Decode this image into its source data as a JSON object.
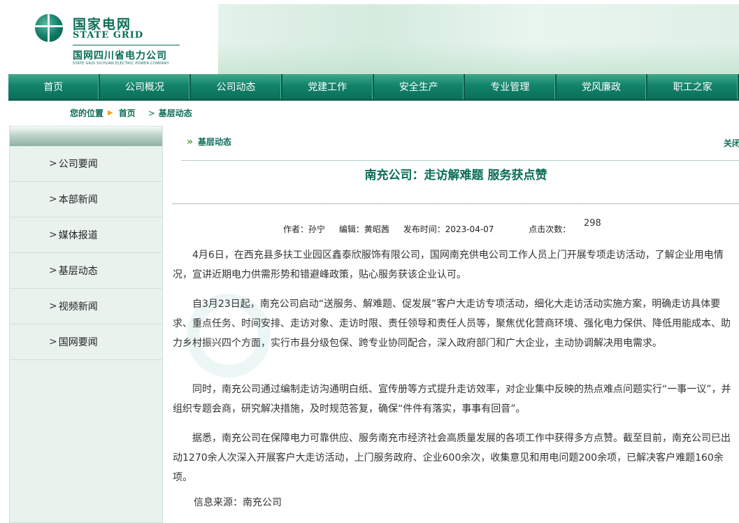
{
  "header": {
    "logo_cn": "国家电网",
    "logo_en": "STATE GRID",
    "company": "国网四川省电力公司",
    "company_en": "STATE GRID SICHUAN ELECTRIC POWER COMPANY"
  },
  "nav": [
    "首页",
    "公司概况",
    "公司动态",
    "党建工作",
    "安全生产",
    "专业管理",
    "党风廉政",
    "职工之家"
  ],
  "breadcrumb": {
    "label": "您的位置",
    "home": "首页",
    "current": "基层动态"
  },
  "sidebar": [
    {
      "label": "公司要闻"
    },
    {
      "label": "本部新闻"
    },
    {
      "label": "媒体报道"
    },
    {
      "label": "基层动态"
    },
    {
      "label": "视频新闻"
    },
    {
      "label": "国网要闻"
    }
  ],
  "content": {
    "section": "基层动态",
    "right_link": "关闭",
    "title": "南充公司：走访解难题 服务获点赞",
    "author": "作者：孙宁",
    "editor": "编辑：黄昭茜",
    "published": "发布时间：2023-04-07",
    "clicks_label": "点击次数：",
    "clicks": "298",
    "paragraphs": [
      "4月6日，在西充县多扶工业园区鑫泰欣服饰有限公司，国网南充供电公司工作人员上门开展专项走访活动，了解企业用电情况，宣讲近期电力供需形势和错避峰政策，贴心服务获该企业认可。",
      "自3月23日起，南充公司启动“送服务、解难题、促发展”客户大走访专项活动，细化大走访活动实施方案，明确走访具体要求、重点任务、时间安排、走访对象、走访时限、责任领导和责任人员等，聚焦优化营商环境、强化电力保供、降低用能成本、助力乡村振兴四个方面，实行市县分级包保、跨专业协同配合，深入政府部门和广大企业，主动协调解决用电需求。",
      "同时，南充公司通过编制走访沟通明白纸、宣传册等方式提升走访效率，对企业集中反映的热点难点问题实行“一事一议”，并组织专题会商，研究解决措施，及时规范答复，确保“件件有落实，事事有回音”。",
      "据悉，南充公司在保障电力可靠供应、服务南充市经济社会高质量发展的各项工作中获得多方点赞。截至目前，南充公司已出动1270余人次深入开展客户大走访活动，上门服务政府、企业600余次，收集意见和用电问题200余项，已解决客户难题160余项。"
    ],
    "source": "信息来源：南充公司"
  },
  "colors": {
    "brand_green": "#0b6e57",
    "nav_green": "#13836a",
    "arrow_orange": "#f2a226"
  }
}
